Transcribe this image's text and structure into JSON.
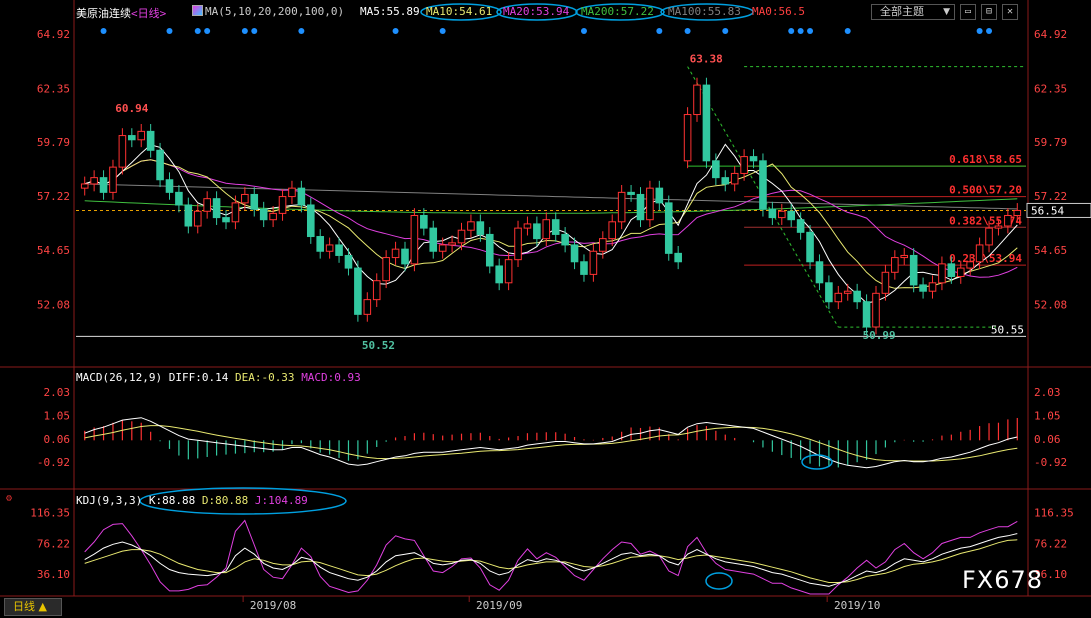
{
  "header": {
    "symbol": "美原油连续",
    "period": "<日线>",
    "ma_params": "MA(5,10,20,200,100,0)",
    "ma5": "MA5:55.89",
    "ma10": "MA10:54.61",
    "ma20": "MA20:53.94",
    "ma200": "MA200:57.22",
    "ma100": "MA100:55.83",
    "ma0": "MA0:56.5",
    "theme_label": "全部主题",
    "theme_caret": "▼"
  },
  "colors": {
    "up": "#ff3232",
    "down": "#32c8a0",
    "ma5": "#ffffff",
    "ma10": "#e8e870",
    "ma20": "#e040e0",
    "ma200": "#808080",
    "ma100": "#40c040",
    "ma0": "#ff4040",
    "axis_label": "#ff4444",
    "highlight": "#00a0e0"
  },
  "chart_data": {
    "type": "candlestick",
    "x_labels": [
      "2019/08",
      "2019/09",
      "2019/10"
    ],
    "y_ticks": [
      "64.92",
      "62.35",
      "59.79",
      "57.22",
      "54.65",
      "52.08"
    ],
    "ylim": [
      50.0,
      65.5
    ],
    "last_price": "56.54",
    "annotations": {
      "high_1": "60.94",
      "low_1": "50.52",
      "high_2": "63.38",
      "low_2": "50.99",
      "support": "50.55"
    },
    "fibonacci": [
      {
        "label": "0.618\\58.65",
        "value": 58.65
      },
      {
        "label": "0.500\\57.20",
        "value": 57.2
      },
      {
        "label": "0.382\\55.74",
        "value": 55.74
      },
      {
        "label": "0.236\\53.94",
        "value": 53.94
      }
    ],
    "close": [
      57.8,
      58.1,
      57.4,
      58.6,
      60.1,
      59.9,
      60.3,
      59.4,
      58.0,
      57.4,
      56.8,
      55.8,
      56.5,
      57.1,
      56.2,
      56.0,
      56.9,
      57.3,
      56.6,
      56.1,
      56.4,
      57.2,
      57.6,
      56.8,
      55.3,
      54.6,
      54.9,
      54.4,
      53.8,
      51.6,
      52.3,
      53.2,
      54.3,
      54.7,
      54.0,
      56.3,
      55.7,
      54.6,
      54.9,
      55.0,
      55.6,
      56.0,
      55.4,
      53.9,
      53.1,
      54.2,
      55.7,
      55.9,
      55.2,
      56.1,
      55.4,
      54.9,
      54.1,
      53.5,
      54.6,
      55.2,
      56.0,
      57.4,
      57.3,
      56.1,
      57.6,
      56.9,
      54.5,
      54.1,
      61.1,
      62.5,
      58.9,
      58.1,
      57.8,
      58.3,
      59.1,
      58.9,
      56.6,
      56.2,
      56.5,
      56.1,
      55.5,
      54.1,
      53.1,
      52.2,
      52.6,
      52.7,
      52.2,
      51.0,
      52.6,
      53.6,
      54.3,
      54.4,
      53.0,
      52.7,
      53.1,
      54.0,
      53.4,
      53.8,
      54.1,
      54.9,
      55.7,
      55.8,
      56.3,
      56.54
    ],
    "open": [
      57.6,
      57.8,
      58.1,
      57.4,
      58.6,
      60.1,
      59.9,
      60.3,
      59.4,
      58.0,
      57.4,
      56.8,
      55.8,
      56.5,
      57.1,
      56.2,
      56.0,
      56.9,
      57.3,
      56.6,
      56.1,
      56.4,
      57.2,
      57.6,
      56.8,
      55.3,
      54.6,
      54.9,
      54.4,
      53.8,
      51.6,
      52.3,
      53.2,
      54.3,
      54.7,
      54.0,
      56.3,
      55.7,
      54.6,
      54.9,
      55.0,
      55.6,
      56.0,
      55.4,
      53.9,
      53.1,
      54.2,
      55.7,
      55.9,
      55.2,
      56.1,
      55.4,
      54.9,
      54.1,
      53.5,
      54.6,
      55.2,
      56.0,
      57.4,
      57.3,
      56.1,
      57.6,
      56.9,
      54.5,
      58.9,
      61.1,
      62.5,
      58.9,
      58.1,
      57.8,
      58.3,
      59.1,
      58.9,
      56.6,
      56.2,
      56.5,
      56.1,
      55.5,
      54.1,
      53.1,
      52.2,
      52.6,
      52.7,
      52.2,
      51.0,
      52.6,
      53.6,
      54.3,
      54.4,
      53.0,
      52.7,
      53.1,
      54.0,
      53.4,
      53.8,
      54.1,
      54.9,
      55.7,
      55.8,
      56.3
    ],
    "macd": {
      "label": "MACD(26,12,9)",
      "diff_label": "DIFF:0.14",
      "dea_label": "DEA:-0.33",
      "macd_label": "MACD:0.93",
      "y_ticks": [
        "2.03",
        "1.05",
        "0.06",
        "-0.92"
      ],
      "ylim": [
        -1.5,
        2.2
      ],
      "diff": [
        0.3,
        0.45,
        0.55,
        0.7,
        0.85,
        0.9,
        0.95,
        0.8,
        0.6,
        0.4,
        0.2,
        0.05,
        0.0,
        -0.05,
        -0.1,
        -0.15,
        -0.2,
        -0.25,
        -0.3,
        -0.35,
        -0.4,
        -0.4,
        -0.3,
        -0.3,
        -0.45,
        -0.6,
        -0.7,
        -0.85,
        -1.0,
        -1.05,
        -1.0,
        -0.9,
        -0.8,
        -0.7,
        -0.65,
        -0.55,
        -0.5,
        -0.5,
        -0.5,
        -0.45,
        -0.4,
        -0.35,
        -0.3,
        -0.35,
        -0.4,
        -0.35,
        -0.3,
        -0.2,
        -0.15,
        -0.1,
        -0.05,
        -0.05,
        -0.1,
        -0.15,
        -0.15,
        -0.1,
        -0.05,
        0.1,
        0.25,
        0.3,
        0.4,
        0.45,
        0.35,
        0.25,
        0.55,
        0.7,
        0.75,
        0.7,
        0.65,
        0.6,
        0.55,
        0.5,
        0.35,
        0.2,
        0.05,
        -0.1,
        -0.25,
        -0.45,
        -0.65,
        -0.8,
        -0.95,
        -1.05,
        -1.1,
        -1.15,
        -1.1,
        -1.0,
        -0.9,
        -0.85,
        -0.9,
        -0.9,
        -0.85,
        -0.75,
        -0.7,
        -0.6,
        -0.5,
        -0.35,
        -0.2,
        -0.1,
        0.05,
        0.14
      ],
      "dea": [
        0.1,
        0.18,
        0.25,
        0.33,
        0.42,
        0.5,
        0.58,
        0.62,
        0.62,
        0.58,
        0.52,
        0.45,
        0.38,
        0.3,
        0.22,
        0.15,
        0.08,
        0.02,
        -0.05,
        -0.1,
        -0.16,
        -0.2,
        -0.22,
        -0.24,
        -0.28,
        -0.34,
        -0.4,
        -0.48,
        -0.57,
        -0.65,
        -0.72,
        -0.76,
        -0.77,
        -0.76,
        -0.74,
        -0.7,
        -0.66,
        -0.63,
        -0.6,
        -0.57,
        -0.54,
        -0.5,
        -0.46,
        -0.44,
        -0.43,
        -0.41,
        -0.39,
        -0.35,
        -0.31,
        -0.27,
        -0.22,
        -0.19,
        -0.17,
        -0.17,
        -0.16,
        -0.15,
        -0.13,
        -0.08,
        -0.02,
        0.04,
        0.11,
        0.18,
        0.22,
        0.23,
        0.3,
        0.38,
        0.45,
        0.5,
        0.53,
        0.55,
        0.55,
        0.54,
        0.5,
        0.44,
        0.36,
        0.27,
        0.16,
        0.04,
        -0.1,
        -0.24,
        -0.38,
        -0.52,
        -0.64,
        -0.74,
        -0.81,
        -0.85,
        -0.86,
        -0.86,
        -0.87,
        -0.87,
        -0.87,
        -0.85,
        -0.82,
        -0.78,
        -0.72,
        -0.65,
        -0.56,
        -0.47,
        -0.39,
        -0.33
      ]
    },
    "kdj": {
      "label": "KDJ(9,3,3)",
      "k_label": "K:88.88",
      "d_label": "D:80.88",
      "j_label": "J:104.89",
      "y_ticks": [
        "116.35",
        "76.22",
        "36.10"
      ],
      "ylim": [
        10,
        125
      ],
      "k": [
        55,
        62,
        70,
        75,
        78,
        74,
        68,
        60,
        50,
        42,
        38,
        36,
        35,
        34,
        36,
        40,
        60,
        70,
        62,
        50,
        44,
        42,
        48,
        58,
        55,
        45,
        38,
        34,
        30,
        28,
        32,
        40,
        52,
        60,
        62,
        64,
        58,
        50,
        48,
        50,
        54,
        55,
        50,
        40,
        35,
        38,
        48,
        55,
        52,
        56,
        54,
        50,
        44,
        40,
        44,
        50,
        56,
        62,
        64,
        60,
        62,
        60,
        52,
        48,
        62,
        68,
        62,
        56,
        52,
        50,
        48,
        46,
        42,
        38,
        36,
        32,
        28,
        24,
        22,
        20,
        24,
        28,
        34,
        40,
        38,
        42,
        50,
        56,
        54,
        52,
        56,
        62,
        66,
        70,
        72,
        76,
        80,
        84,
        86,
        88.88
      ],
      "d": [
        50,
        54,
        58,
        62,
        66,
        68,
        68,
        66,
        62,
        56,
        50,
        46,
        42,
        40,
        38,
        38,
        44,
        52,
        56,
        54,
        50,
        48,
        48,
        52,
        53,
        51,
        47,
        43,
        39,
        35,
        34,
        36,
        41,
        47,
        52,
        56,
        57,
        55,
        53,
        52,
        53,
        54,
        53,
        49,
        45,
        43,
        45,
        48,
        50,
        52,
        52,
        52,
        49,
        46,
        45,
        47,
        50,
        54,
        58,
        59,
        60,
        60,
        58,
        55,
        57,
        60,
        61,
        59,
        57,
        55,
        53,
        51,
        48,
        45,
        42,
        39,
        35,
        31,
        28,
        25,
        25,
        26,
        29,
        33,
        35,
        37,
        41,
        46,
        49,
        50,
        52,
        55,
        59,
        63,
        66,
        69,
        73,
        77,
        80,
        80.88
      ],
      "j": [
        65,
        78,
        94,
        101,
        102,
        86,
        68,
        48,
        26,
        14,
        14,
        16,
        21,
        22,
        32,
        44,
        92,
        106,
        74,
        42,
        32,
        30,
        48,
        70,
        59,
        33,
        20,
        16,
        12,
        14,
        28,
        48,
        74,
        86,
        82,
        80,
        60,
        40,
        38,
        46,
        56,
        57,
        44,
        22,
        15,
        28,
        54,
        69,
        56,
        64,
        58,
        46,
        34,
        28,
        42,
        56,
        68,
        78,
        76,
        62,
        66,
        60,
        40,
        34,
        72,
        84,
        64,
        50,
        42,
        40,
        38,
        36,
        30,
        24,
        24,
        18,
        14,
        10,
        10,
        10,
        22,
        32,
        44,
        54,
        44,
        52,
        68,
        76,
        64,
        56,
        64,
        76,
        80,
        84,
        84,
        90,
        94,
        98,
        98,
        104.89
      ]
    }
  },
  "footer": {
    "period_button": "日线 ▲",
    "watermark": "FX678"
  }
}
